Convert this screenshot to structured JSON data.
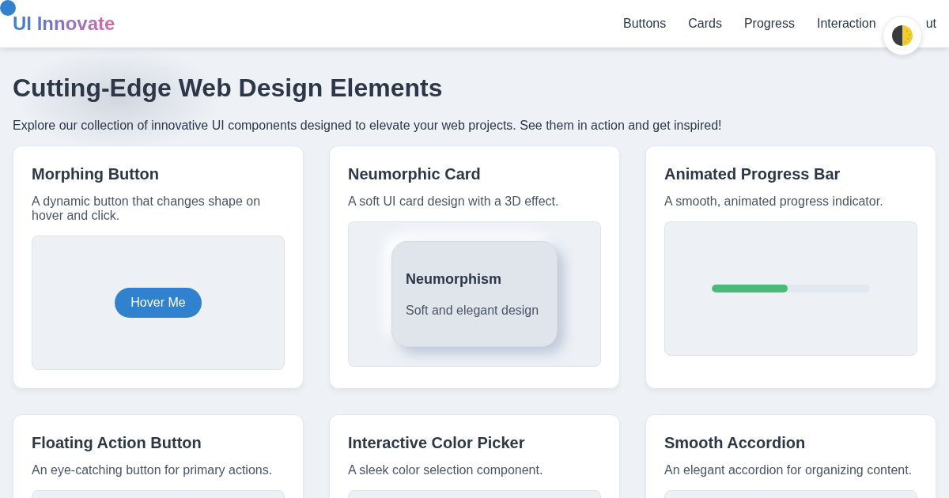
{
  "header": {
    "logo": "UI Innovate",
    "nav": [
      "Buttons",
      "Cards",
      "Progress",
      "Interaction",
      "ut"
    ]
  },
  "hero": {
    "title": "Cutting-Edge Web Design Elements",
    "subtitle": "Explore our collection of innovative UI components designed to elevate your web projects. See them in action and get inspired!"
  },
  "cards": [
    {
      "title": "Morphing Button",
      "description": "A dynamic button that changes shape on hover and click.",
      "demo": {
        "kind": "button",
        "label": "Hover Me"
      }
    },
    {
      "title": "Neumorphic Card",
      "description": "A soft UI card design with a 3D effect.",
      "demo": {
        "kind": "neumorphic",
        "title": "Neumorphism",
        "text": "Soft and elegant design"
      }
    },
    {
      "title": "Animated Progress Bar",
      "description": "A smooth, animated progress indicator.",
      "demo": {
        "kind": "progress",
        "level": 0.48
      }
    },
    {
      "title": "Floating Action Button",
      "description": "An eye-catching button for primary actions."
    },
    {
      "title": "Interactive Color Picker",
      "description": "A sleek color selection component."
    },
    {
      "title": "Smooth Accordion",
      "description": "An elegant accordion for organizing content."
    }
  ]
}
